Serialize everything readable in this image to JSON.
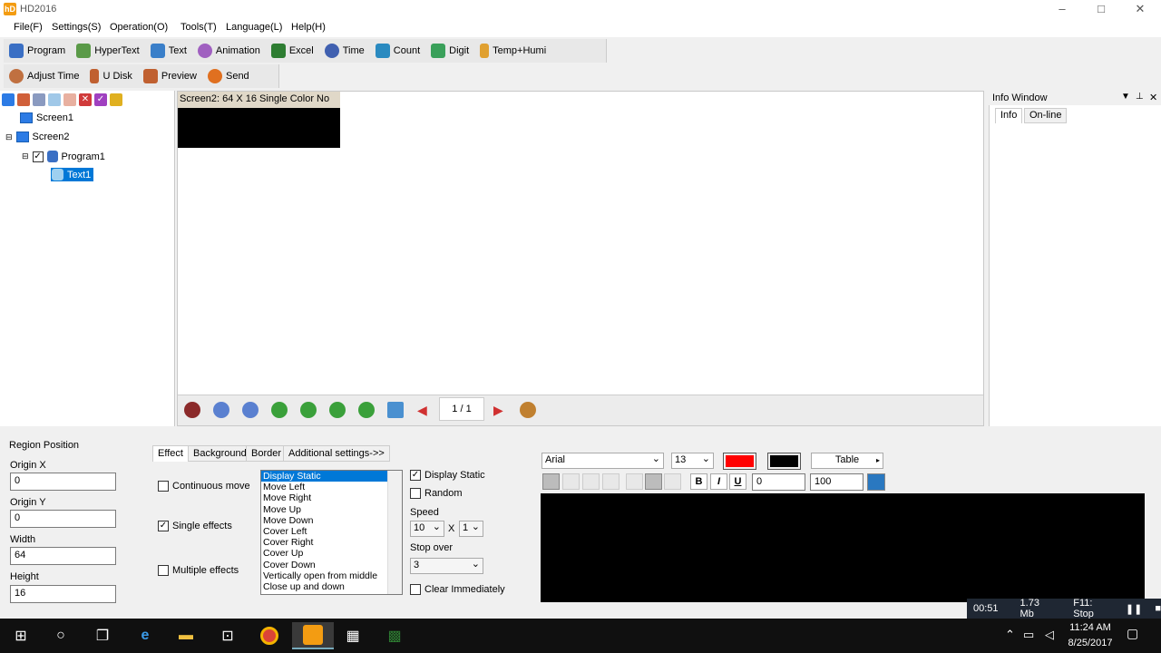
{
  "window": {
    "title": "HD2016",
    "min": "–",
    "max": "□",
    "close": "✕"
  },
  "menu": [
    "File(F)",
    "Settings(S)",
    "Operation(O)",
    "Tools(T)",
    "Language(L)",
    "Help(H)"
  ],
  "toolbar1": [
    {
      "label": "Program",
      "icon": "program-icon",
      "color": "#3a6fc4"
    },
    {
      "label": "HyperText",
      "icon": "hypertext-icon",
      "color": "#5a9a48"
    },
    {
      "label": "Text",
      "icon": "text-icon",
      "color": "#3a7fc9"
    },
    {
      "label": "Animation",
      "icon": "animation-icon",
      "color": "#a060c0"
    },
    {
      "label": "Excel",
      "icon": "excel-icon",
      "color": "#2e7d32"
    },
    {
      "label": "Time",
      "icon": "clock-icon",
      "color": "#4060b0"
    },
    {
      "label": "Count",
      "icon": "count-icon",
      "color": "#2a8ac0"
    },
    {
      "label": "Digit",
      "icon": "digit-icon",
      "color": "#3aa05a"
    },
    {
      "label": "Temp+Humi",
      "icon": "thermometer-icon",
      "color": "#e0a030"
    }
  ],
  "toolbar2": [
    {
      "label": "Adjust Time",
      "icon": "adjust-time-icon",
      "color": "#c07040"
    },
    {
      "label": "U Disk",
      "icon": "udisk-icon",
      "color": "#c06030"
    },
    {
      "label": "Preview",
      "icon": "preview-icon",
      "color": "#c06030"
    },
    {
      "label": "Send",
      "icon": "send-icon",
      "color": "#e07020"
    }
  ],
  "tree": {
    "screen1": "Screen1",
    "screen2": "Screen2",
    "program1": "Program1",
    "text1": "Text1"
  },
  "canvas": {
    "screen_label": "Screen2: 64 X 16  Single Color No",
    "page": "1 / 1"
  },
  "info": {
    "title": "Info Window",
    "tab_info": "Info",
    "tab_online": "On-line"
  },
  "region": {
    "title": "Region Position",
    "origin_x_label": "Origin X",
    "origin_x": "0",
    "origin_y_label": "Origin Y",
    "origin_y": "0",
    "width_label": "Width",
    "width": "64",
    "height_label": "Height",
    "height": "16"
  },
  "tabs": [
    "Effect",
    "Background",
    "Border",
    "Additional settings->>"
  ],
  "effect": {
    "continuous": "Continuous move",
    "single": "Single effects",
    "multiple": "Multiple effects",
    "list": [
      "Display Static",
      "Move Left",
      "Move Right",
      "Move Up",
      "Move Down",
      "Cover Left",
      "Cover Right",
      "Cover Up",
      "Cover Down",
      "Vertically open from middle",
      "Close up and down"
    ],
    "display_static": "Display Static",
    "random": "Random",
    "speed_label": "Speed",
    "speed": "10",
    "x": "X",
    "speed2": "1",
    "stop_label": "Stop over",
    "stop": "3",
    "clear": "Clear Immediately"
  },
  "format": {
    "font": "Arial",
    "size": "13",
    "text_color": "#ff0000",
    "bg_color": "#000000",
    "table": "Table",
    "bold": "B",
    "italic": "I",
    "underline": "U",
    "spacing": "0",
    "scale": "100"
  },
  "status": {
    "time": "00:51",
    "size": "1.73 Mb",
    "stop": "F11: Stop"
  },
  "taskbar": {
    "clock": "11:24 AM",
    "date": "8/25/2017"
  }
}
